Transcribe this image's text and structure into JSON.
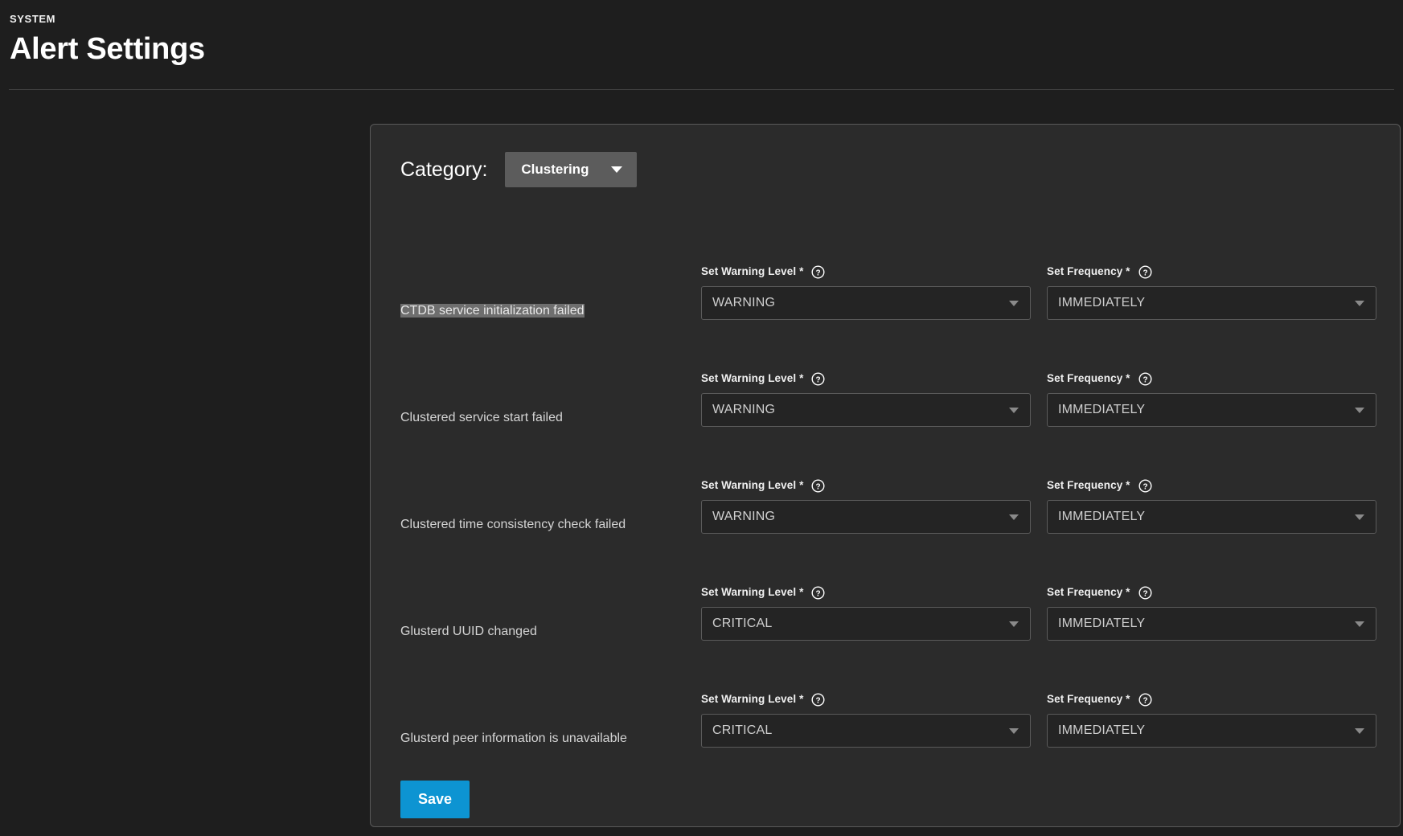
{
  "header": {
    "eyebrow": "SYSTEM",
    "title": "Alert Settings"
  },
  "category": {
    "label": "Category:",
    "selected": "Clustering",
    "caret_icon": "chevron-down-icon"
  },
  "field_labels": {
    "warning_level": "Set Warning Level *",
    "frequency": "Set Frequency *",
    "help_icon": "help-circle-icon",
    "caret_icon": "chevron-down-icon"
  },
  "alerts": [
    {
      "name": "CTDB service initialization failed",
      "selected": true,
      "warning_level": "WARNING",
      "frequency": "IMMEDIATELY"
    },
    {
      "name": "Clustered service start failed",
      "selected": false,
      "warning_level": "WARNING",
      "frequency": "IMMEDIATELY"
    },
    {
      "name": "Clustered time consistency check failed",
      "selected": false,
      "warning_level": "WARNING",
      "frequency": "IMMEDIATELY"
    },
    {
      "name": "Glusterd UUID changed",
      "selected": false,
      "warning_level": "CRITICAL",
      "frequency": "IMMEDIATELY"
    },
    {
      "name": "Glusterd peer information is unavailable",
      "selected": false,
      "warning_level": "CRITICAL",
      "frequency": "IMMEDIATELY"
    }
  ],
  "actions": {
    "save_label": "Save"
  },
  "colors": {
    "page_background": "#1e1e1e",
    "panel_background": "#2b2b2b",
    "panel_border": "#5a5a5a",
    "accent_save": "#0d94d2",
    "category_button": "#5c5c5c",
    "selection_highlight": "#6e6e6e",
    "select_background": "#242424"
  }
}
